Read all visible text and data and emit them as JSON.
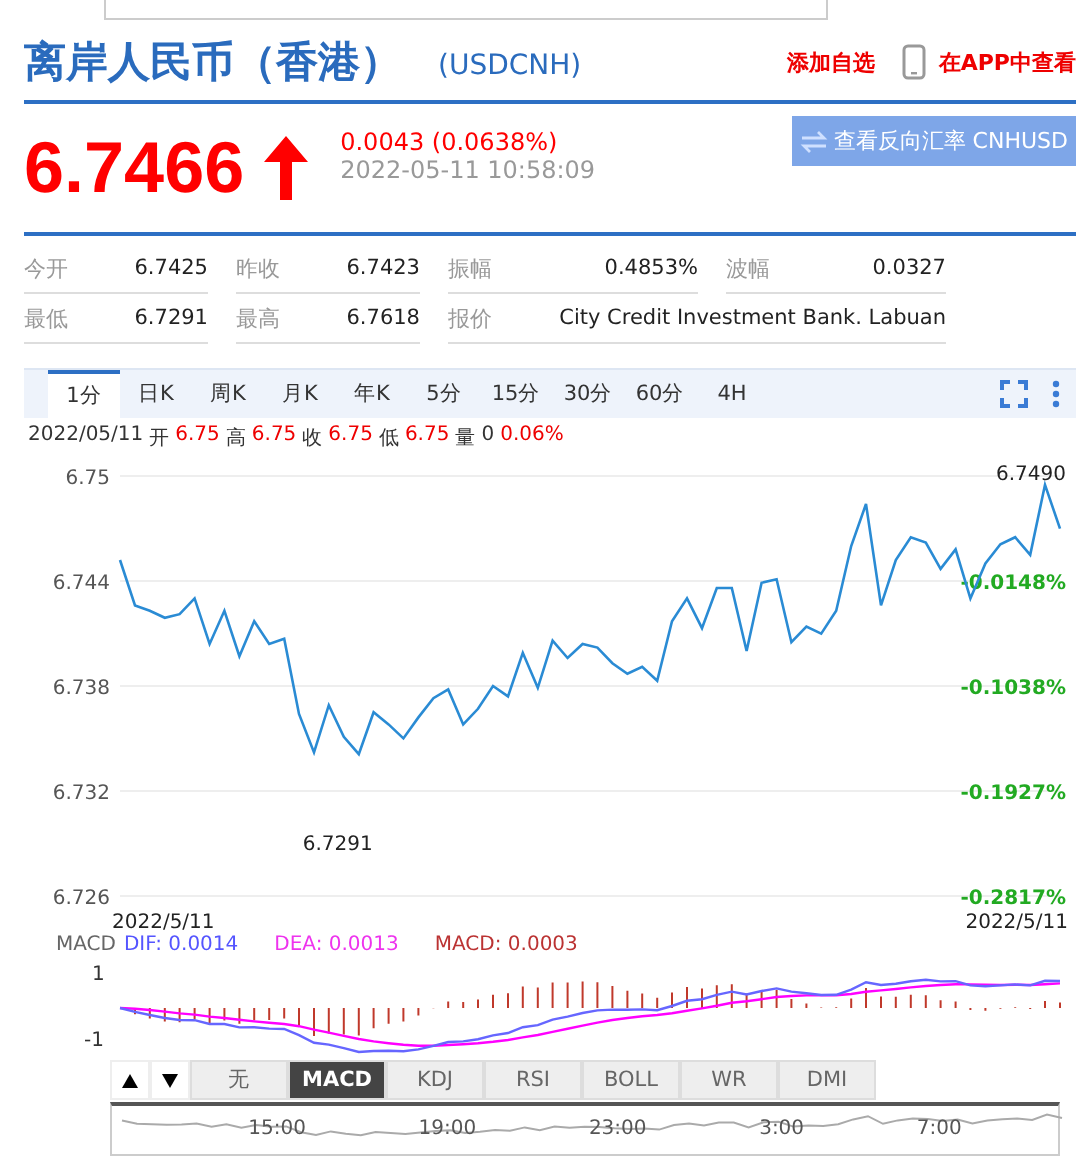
{
  "title": "离岸人民币（香港）",
  "symbol": "(USDCNH)",
  "actions": [
    {
      "label": "添加自选",
      "kind": "plain"
    },
    {
      "label": "在APP中查看",
      "kind": "app"
    }
  ],
  "quote": {
    "price": "6.7466",
    "rising": true,
    "change": "0.0043 (0.0638%)",
    "time": "2022-05-11 10:58:09"
  },
  "reverse_button": "查看反向汇率 CNHUSD",
  "stats": [
    [
      {
        "label": "今开",
        "value": "6.7425"
      },
      {
        "label": "昨收",
        "value": "6.7423"
      },
      {
        "label": "振幅",
        "value": "0.4853%"
      },
      {
        "label": "波幅",
        "value": "0.0327"
      }
    ],
    [
      {
        "label": "最低",
        "value": "6.7291"
      },
      {
        "label": "最高",
        "value": "6.7618"
      },
      {
        "label": "报价",
        "value": "City Credit Investment Bank. Labuan"
      }
    ]
  ],
  "chart_tabs": [
    {
      "label": "1分",
      "selected": true
    },
    {
      "label": "日K",
      "selected": false
    },
    {
      "label": "周K",
      "selected": false
    },
    {
      "label": "月K",
      "selected": false
    },
    {
      "label": "年K",
      "selected": false
    },
    {
      "label": "5分",
      "selected": false
    },
    {
      "label": "15分",
      "selected": false
    },
    {
      "label": "30分",
      "selected": false
    },
    {
      "label": "60分",
      "selected": false
    },
    {
      "label": "4H",
      "selected": false
    }
  ],
  "bar_info": {
    "date": "2022/05/11",
    "items": [
      {
        "label": "开",
        "value": "6.75",
        "kind": "price"
      },
      {
        "label": "高",
        "value": "6.75",
        "kind": "price"
      },
      {
        "label": "收",
        "value": "6.75",
        "kind": "price"
      },
      {
        "label": "低",
        "value": "6.75",
        "kind": "price"
      },
      {
        "label": "量",
        "value": "0",
        "kind": "plain"
      }
    ],
    "change": "0.06%"
  },
  "chart": {
    "chart_data": {
      "type": "line",
      "grid": true,
      "ylim": [
        6.726,
        6.75
      ],
      "yticks": [
        {
          "value": 6.75,
          "label": "6.75"
        },
        {
          "value": 6.744,
          "label": "6.744"
        },
        {
          "value": 6.738,
          "label": "6.738"
        },
        {
          "value": 6.732,
          "label": "6.732"
        },
        {
          "value": 6.726,
          "label": "6.726"
        }
      ],
      "series": [
        {
          "color": "#2a8bd4",
          "values": [
            6.7452,
            6.7426,
            6.7423,
            6.7419,
            6.7421,
            6.743,
            6.7404,
            6.7423,
            6.7397,
            6.7417,
            6.7404,
            6.7407,
            6.7364,
            6.7342,
            6.7369,
            6.7351,
            6.7341,
            6.7365,
            6.7358,
            6.735,
            6.7362,
            6.7373,
            6.7378,
            6.7358,
            6.7367,
            6.738,
            6.7374,
            6.7399,
            6.7379,
            6.7406,
            6.7396,
            6.7404,
            6.7402,
            6.7393,
            6.7387,
            6.7391,
            6.7383,
            6.7417,
            6.743,
            6.7413,
            6.7436,
            6.7436,
            6.74,
            6.7439,
            6.7441,
            6.7405,
            6.7414,
            6.741,
            6.7423,
            6.746,
            6.7484,
            6.7426,
            6.7452,
            6.7465,
            6.7462,
            6.7447,
            6.7458,
            6.743,
            6.745,
            6.7461,
            6.7465,
            6.7455,
            6.7495,
            6.747
          ]
        }
      ]
    },
    "right_labels": [
      "-0.0148%",
      "-0.1038%",
      "-0.1927%",
      "-0.2817%"
    ],
    "low_label": "6.7291",
    "high_label": "6.7490"
  },
  "macd": {
    "start_date": "2022/5/11",
    "end_date": "2022/5/11",
    "name": "MACD",
    "dif": "DIF: 0.0014",
    "dea": "DEA: 0.0013",
    "macd": "MACD: 0.0003",
    "top_tick": "1",
    "bottom_tick": "-1"
  },
  "indicator_tabs": [
    {
      "label": "无",
      "selected": false
    },
    {
      "label": "MACD",
      "selected": true
    },
    {
      "label": "KDJ",
      "selected": false
    },
    {
      "label": "RSI",
      "selected": false
    },
    {
      "label": "BOLL",
      "selected": false
    },
    {
      "label": "WR",
      "selected": false
    },
    {
      "label": "DMI",
      "selected": false
    }
  ],
  "navigator": {
    "times": [
      "15:00",
      "19:00",
      "23:00",
      "3:00",
      "7:00"
    ]
  }
}
